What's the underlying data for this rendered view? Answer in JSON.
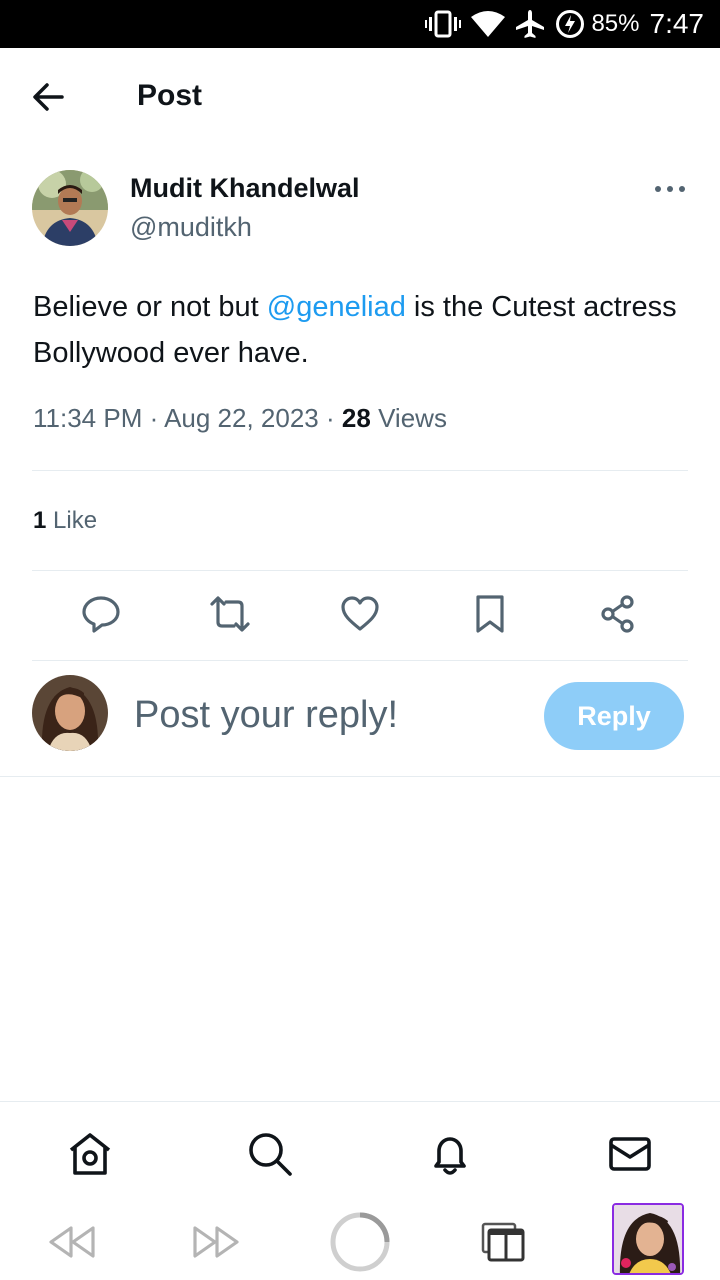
{
  "status_bar": {
    "battery_percent": "85%",
    "time": "7:47"
  },
  "header": {
    "title": "Post"
  },
  "post": {
    "author_name": "Mudit Khandelwal",
    "author_handle": "@muditkh",
    "text_before": "Believe or not but ",
    "mention": "@geneliad",
    "text_after": " is the Cutest actress Bollywood ever have.",
    "time": "11:34 PM",
    "date": "Aug 22, 2023",
    "views_count": "28",
    "views_label": "Views",
    "likes_count": "1",
    "likes_label": "Like",
    "separator": "·"
  },
  "reply": {
    "placeholder": "Post your reply!",
    "button_label": "Reply"
  },
  "colors": {
    "accent": "#1d9bf0",
    "reply_button": "#8ecdf8",
    "secondary_text": "#536471"
  }
}
